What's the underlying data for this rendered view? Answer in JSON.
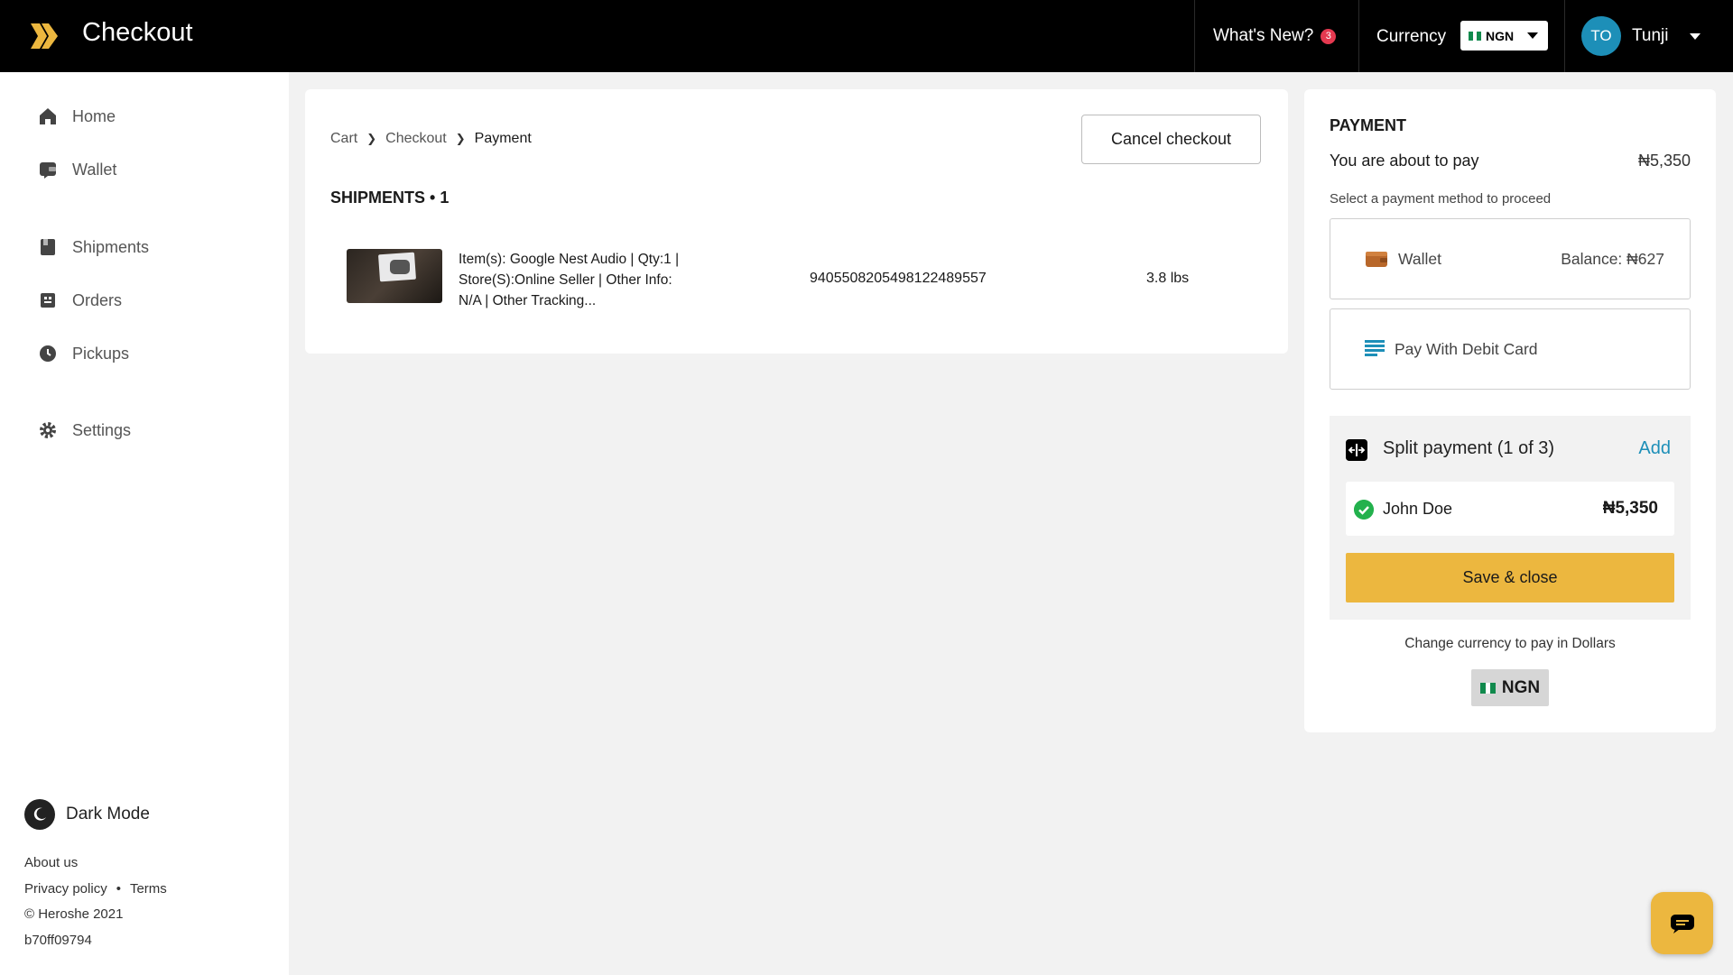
{
  "header": {
    "title": "Checkout",
    "whats_new_label": "What's New?",
    "whats_new_count": "3",
    "currency_label": "Currency",
    "currency_value": "NGN",
    "user_initials": "TO",
    "user_name": "Tunji"
  },
  "sidebar": {
    "items": [
      {
        "label": "Home",
        "icon": "home-icon"
      },
      {
        "label": "Wallet",
        "icon": "wallet-icon"
      },
      {
        "label": "Shipments",
        "icon": "shipments-icon"
      },
      {
        "label": "Orders",
        "icon": "orders-icon"
      },
      {
        "label": "Pickups",
        "icon": "pickups-icon"
      },
      {
        "label": "Settings",
        "icon": "gear-icon"
      }
    ],
    "dark_mode_label": "Dark Mode",
    "footer": {
      "about": "About us",
      "privacy": "Privacy policy",
      "separator": "•",
      "terms": "Terms",
      "copyright": "© Heroshe 2021",
      "build": "b70ff09794"
    }
  },
  "checkout": {
    "breadcrumb": [
      "Cart",
      "Checkout",
      "Payment"
    ],
    "cancel_label": "Cancel checkout",
    "shipments_heading": "SHIPMENTS • 1",
    "shipments": [
      {
        "description": "Item(s): Google Nest Audio | Qty:1 | Store(S):Online Seller | Other Info: N/A | Other Tracking...",
        "tracking": "9405508205498122489557",
        "weight": "3.8 lbs"
      }
    ]
  },
  "payment": {
    "title": "PAYMENT",
    "about_label": "You are about to pay",
    "about_amount": "₦5,350",
    "select_note": "Select a payment method to proceed",
    "methods": [
      {
        "label": "Wallet",
        "right": "Balance: ₦627",
        "icon": "wallet-icon"
      },
      {
        "label": "Pay With Debit Card",
        "right": "",
        "icon": "card-icon"
      }
    ],
    "split": {
      "title": "Split payment (1 of 3)",
      "add_label": "Add",
      "payers": [
        {
          "name": "John Doe",
          "amount": "₦5,350"
        }
      ],
      "save_label": "Save & close"
    },
    "change_note": "Change currency to pay in Dollars",
    "currency_button": "NGN"
  },
  "colors": {
    "accent": "#ecb73f",
    "link": "#1d8fb8",
    "success": "#23b14d",
    "badge": "#e53950"
  }
}
